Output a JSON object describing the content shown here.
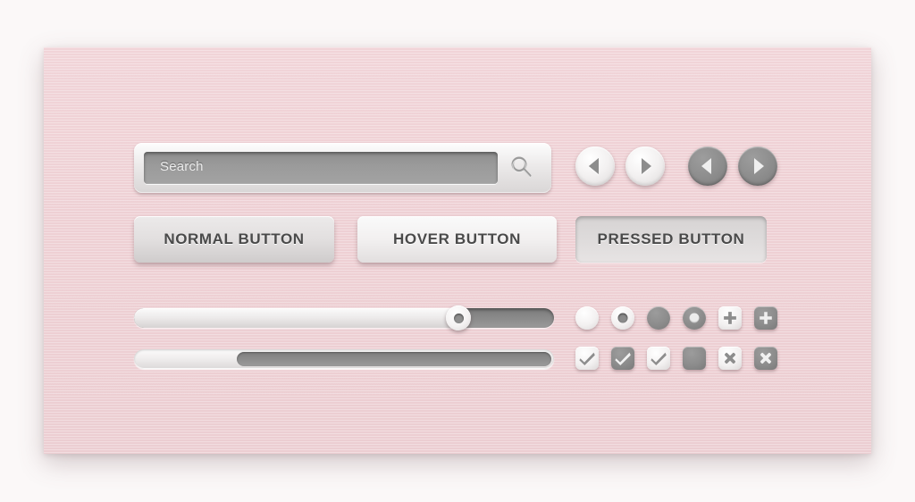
{
  "panel": {
    "background_color": "#eed0d4"
  },
  "search": {
    "placeholder": "Search",
    "value": "",
    "icon": "search-icon"
  },
  "nav_buttons": [
    {
      "name": "prev-light",
      "icon": "chevron-left-icon",
      "style": "light",
      "direction": "left"
    },
    {
      "name": "next-light",
      "icon": "chevron-right-icon",
      "style": "light",
      "direction": "right"
    },
    {
      "name": "prev-dark",
      "icon": "chevron-left-icon",
      "style": "dark",
      "direction": "left"
    },
    {
      "name": "next-dark",
      "icon": "chevron-right-icon",
      "style": "dark",
      "direction": "right"
    }
  ],
  "buttons": [
    {
      "label": "NORMAL BUTTON",
      "state": "normal"
    },
    {
      "label": "HOVER BUTTON",
      "state": "hover"
    },
    {
      "label": "PRESSED BUTTON",
      "state": "pressed"
    }
  ],
  "slider": {
    "value": 76,
    "min": 0,
    "max": 100
  },
  "progress": {
    "value": 25,
    "min": 0,
    "max": 100
  },
  "radio_row": [
    {
      "name": "radio-light-off",
      "style": "light",
      "checked": false,
      "icon": "radio-icon"
    },
    {
      "name": "radio-light-on",
      "style": "light",
      "checked": true,
      "icon": "radio-icon"
    },
    {
      "name": "radio-dark-off",
      "style": "dark",
      "checked": false,
      "icon": "radio-icon"
    },
    {
      "name": "radio-dark-on",
      "style": "dark",
      "checked": true,
      "icon": "radio-icon"
    },
    {
      "name": "plus-light",
      "style": "light",
      "icon": "plus-icon"
    },
    {
      "name": "plus-dark",
      "style": "dark",
      "icon": "plus-icon"
    }
  ],
  "checkbox_row": [
    {
      "name": "checkbox-light-checked",
      "style": "light",
      "icon": "check-icon"
    },
    {
      "name": "checkbox-dark-checked",
      "style": "dark",
      "icon": "check-icon"
    },
    {
      "name": "checkbox-light-checked-2",
      "style": "light",
      "icon": "check-icon"
    },
    {
      "name": "checkbox-dark-empty",
      "style": "dark",
      "icon": "none"
    },
    {
      "name": "close-light",
      "style": "light",
      "icon": "close-icon"
    },
    {
      "name": "close-dark",
      "style": "dark",
      "icon": "close-icon"
    }
  ],
  "colors": {
    "panel_pink": "#eed0d4",
    "page_background": "#fbf8f8",
    "control_light": "#f3f1f1",
    "control_dark": "#8c8c8c",
    "text_gray": "#4a4a4a",
    "field_gray": "#9a9a9a"
  }
}
